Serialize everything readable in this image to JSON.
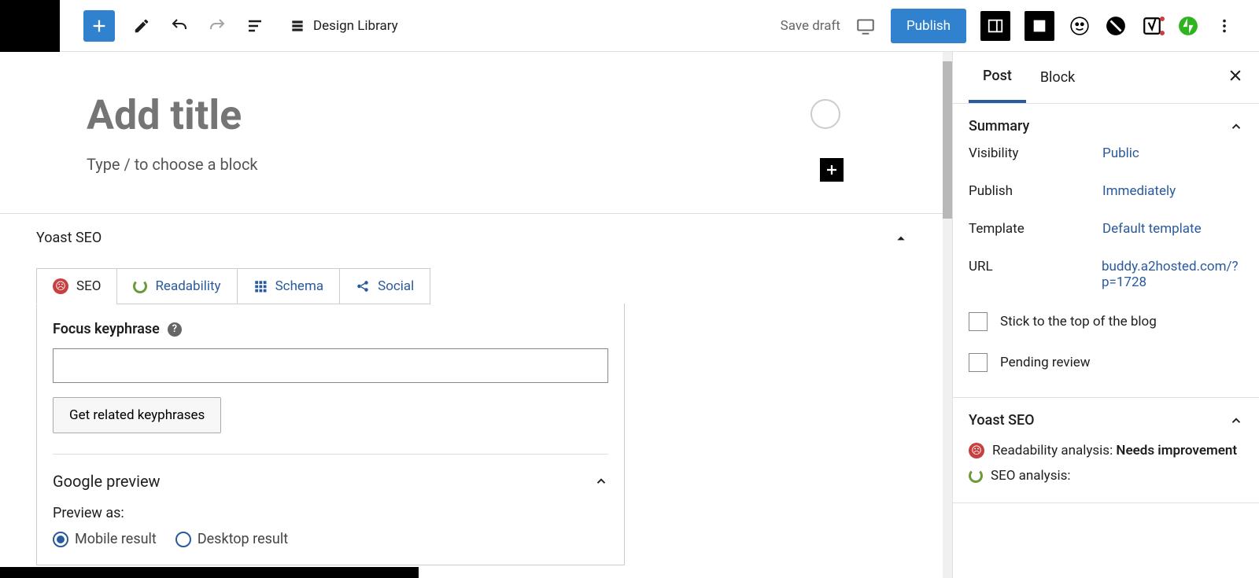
{
  "toolbar": {
    "design_library": "Design Library",
    "save_draft": "Save draft",
    "publish": "Publish"
  },
  "editor": {
    "title_placeholder": "Add title",
    "block_prompt": "Type / to choose a block"
  },
  "yoast": {
    "title": "Yoast SEO",
    "tabs": {
      "seo": "SEO",
      "readability": "Readability",
      "schema": "Schema",
      "social": "Social"
    },
    "focus_keyphrase_label": "Focus keyphrase",
    "get_related": "Get related keyphrases",
    "google_preview": "Google preview",
    "preview_as": "Preview as:",
    "mobile_result": "Mobile result",
    "desktop_result": "Desktop result"
  },
  "sidebar": {
    "tabs": {
      "post": "Post",
      "block": "Block"
    },
    "summary": {
      "title": "Summary",
      "visibility_label": "Visibility",
      "visibility_value": "Public",
      "publish_label": "Publish",
      "publish_value": "Immediately",
      "template_label": "Template",
      "template_value": "Default template",
      "url_label": "URL",
      "url_value": "buddy.a2hosted.com/?p=1728",
      "stick_top": "Stick to the top of the blog",
      "pending_review": "Pending review"
    },
    "yoast_section": {
      "title": "Yoast SEO",
      "readability_label": "Readability analysis: ",
      "readability_value": "Needs improvement",
      "seo_label": "SEO analysis:"
    }
  }
}
